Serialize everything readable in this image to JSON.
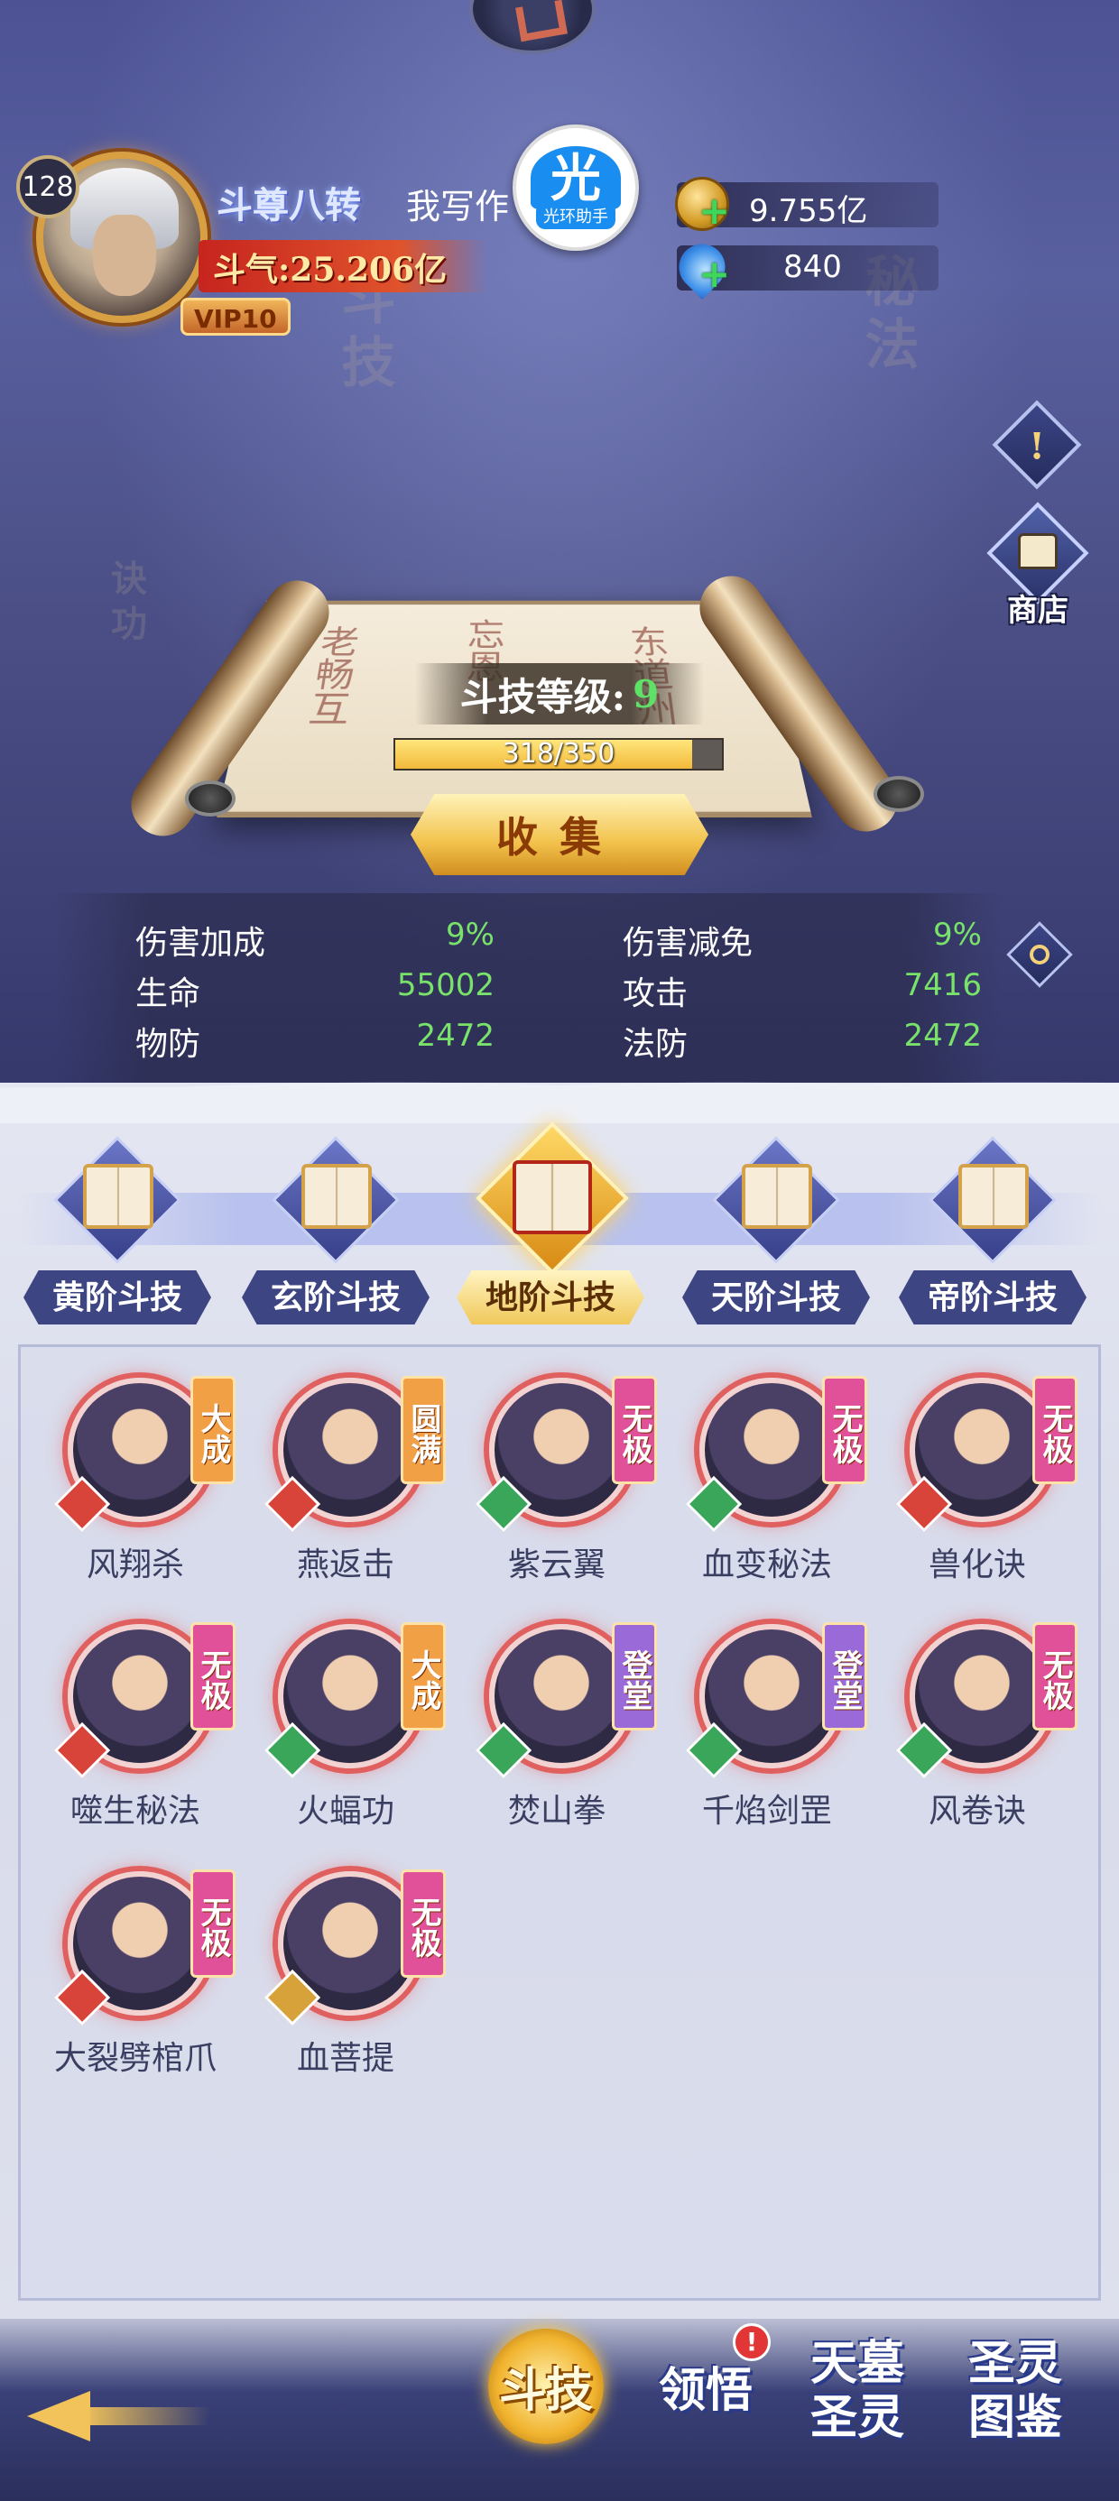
{
  "player": {
    "level": "128",
    "rank_title": "斗尊八转",
    "name": "我写作",
    "power": "斗气:25.206亿",
    "vip": "VIP10"
  },
  "helper_badge": {
    "glyph": "光",
    "label": "光环助手"
  },
  "currencies": [
    {
      "icon": "gold-coin-icon",
      "value": "9.755亿"
    },
    {
      "icon": "blue-gem-icon",
      "value": "840"
    }
  ],
  "side_buttons": {
    "notice_glyph": "!",
    "shop_label": "商店"
  },
  "scroll": {
    "level_label": "斗技等级:",
    "level_value": "9",
    "progress_text": "318/350",
    "progress_fraction": 0.9086,
    "collect_label": "收集"
  },
  "stats": [
    {
      "label": "伤害加成",
      "value": "9%"
    },
    {
      "label": "伤害减免",
      "value": "9%"
    },
    {
      "label": "生命",
      "value": "55002"
    },
    {
      "label": "攻击",
      "value": "7416"
    },
    {
      "label": "物防",
      "value": "2472"
    },
    {
      "label": "法防",
      "value": "2472"
    }
  ],
  "tiers": [
    {
      "label": "黄阶斗技",
      "active": false
    },
    {
      "label": "玄阶斗技",
      "active": false
    },
    {
      "label": "地阶斗技",
      "active": true
    },
    {
      "label": "天阶斗技",
      "active": false
    },
    {
      "label": "帝阶斗技",
      "active": false
    }
  ],
  "skills": [
    {
      "name": "风翔杀",
      "rank": "大成",
      "rank_color": "#f2a046",
      "type_color": "#d9443a"
    },
    {
      "name": "燕返击",
      "rank": "圆满",
      "rank_color": "#f2a046",
      "type_color": "#d9443a"
    },
    {
      "name": "紫云翼",
      "rank": "无极",
      "rank_color": "#e0519a",
      "type_color": "#3aa65a"
    },
    {
      "name": "血变秘法",
      "rank": "无极",
      "rank_color": "#e0519a",
      "type_color": "#3aa65a"
    },
    {
      "name": "兽化诀",
      "rank": "无极",
      "rank_color": "#e0519a",
      "type_color": "#d9443a"
    },
    {
      "name": "噬生秘法",
      "rank": "无极",
      "rank_color": "#e0519a",
      "type_color": "#d9443a"
    },
    {
      "name": "火蝠功",
      "rank": "大成",
      "rank_color": "#f2a046",
      "type_color": "#3aa65a"
    },
    {
      "name": "焚山拳",
      "rank": "登堂",
      "rank_color": "#9a6ad8",
      "type_color": "#3aa65a"
    },
    {
      "name": "千焰剑罡",
      "rank": "登堂",
      "rank_color": "#9a6ad8",
      "type_color": "#3aa65a"
    },
    {
      "name": "风卷诀",
      "rank": "无极",
      "rank_color": "#e0519a",
      "type_color": "#3aa65a"
    },
    {
      "name": "大裂劈棺爪",
      "rank": "无极",
      "rank_color": "#e0519a",
      "type_color": "#d9443a"
    },
    {
      "name": "血菩提",
      "rank": "无极",
      "rank_color": "#e0519a",
      "type_color": "#d8a23a"
    }
  ],
  "bottom_nav": [
    {
      "label": "斗技",
      "active": true,
      "badge": ""
    },
    {
      "label": "领悟",
      "active": false,
      "badge": "!"
    },
    {
      "label": "天墓圣灵",
      "active": false,
      "badge": ""
    },
    {
      "label": "圣灵图鉴",
      "active": false,
      "badge": ""
    }
  ]
}
